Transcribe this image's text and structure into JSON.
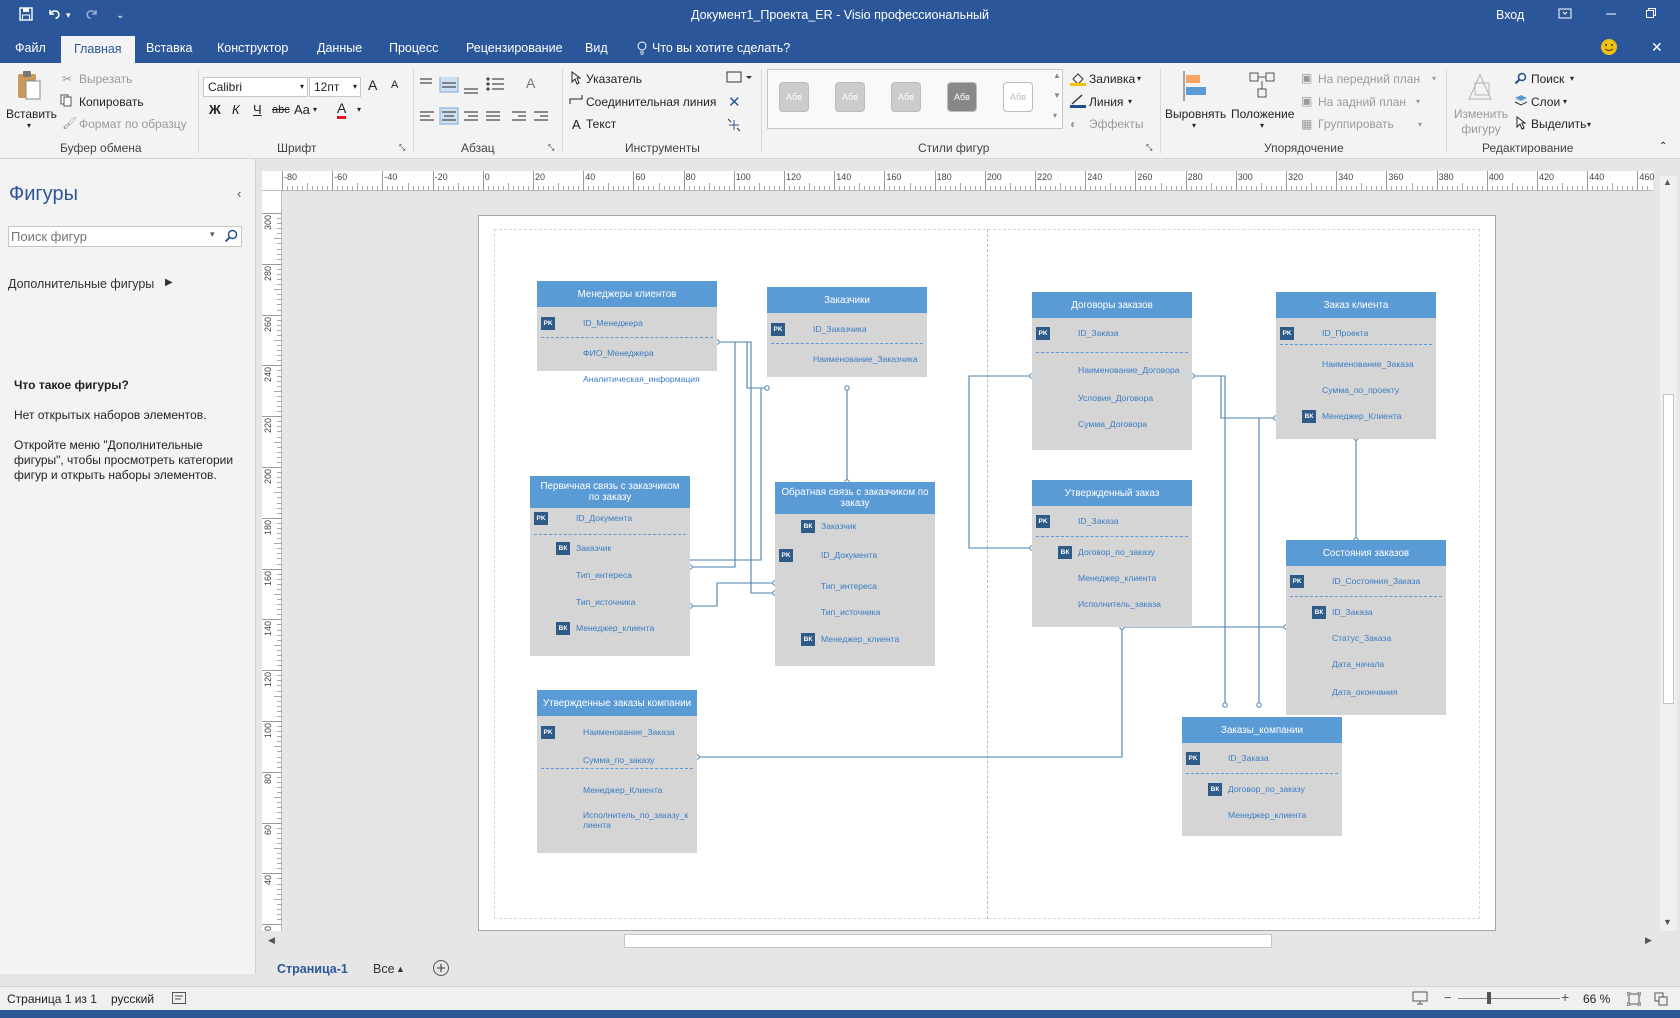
{
  "window": {
    "title": "Документ1_Проекта_ER  -  Visio профессиональный",
    "signin": "Вход"
  },
  "tabs": [
    "Файл",
    "Главная",
    "Вставка",
    "Конструктор",
    "Данные",
    "Процесс",
    "Рецензирование",
    "Вид"
  ],
  "tell_me": "Что вы хотите сделать?",
  "ribbon": {
    "clipboard": {
      "paste": "Вставить",
      "cut": "Вырезать",
      "copy": "Копировать",
      "format_painter": "Формат по образцу",
      "label": "Буфер обмена"
    },
    "font": {
      "family": "Calibri",
      "size": "12пт",
      "bold": "Ж",
      "italic": "К",
      "underline": "Ч",
      "strike": "abc",
      "case": "Aa",
      "color_letter": "A",
      "grow": "A",
      "shrink": "A",
      "label": "Шрифт"
    },
    "paragraph": {
      "label": "Абзац"
    },
    "tools": {
      "pointer": "Указатель",
      "connector": "Соединительная линия",
      "text": "Текст",
      "label": "Инструменты"
    },
    "styles": {
      "sample": "Абв",
      "label": "Стили фигур",
      "fill": "Заливка",
      "line": "Линия",
      "effects": "Эффекты"
    },
    "arrange": {
      "align": "Выровнять",
      "position": "Положение",
      "front": "На передний план",
      "back": "На задний план",
      "group": "Группировать",
      "label": "Упорядочение"
    },
    "editing": {
      "change_shape": "Изменить фигуру",
      "find": "Поиск",
      "layers": "Слои",
      "select": "Выделить",
      "label": "Редактирование"
    }
  },
  "shapes_panel": {
    "title": "Фигуры",
    "search_placeholder": "Поиск фигур",
    "more_shapes": "Дополнительные фигуры",
    "help_title": "Что такое фигуры?",
    "help_text1": "Нет открытых наборов элементов.",
    "help_text2": "Откройте меню \"Дополнительные фигуры\", чтобы просмотреть категории фигур и открыть наборы элементов."
  },
  "ruler_h": [
    "-80",
    "-60",
    "-40",
    "-20",
    "0",
    "20",
    "40",
    "60",
    "80",
    "100",
    "120",
    "140",
    "160",
    "180",
    "200",
    "220",
    "240",
    "260",
    "280",
    "300",
    "320",
    "340",
    "360",
    "380",
    "400",
    "420",
    "440",
    "460"
  ],
  "ruler_v": [
    "300",
    "280",
    "260",
    "240",
    "220",
    "200",
    "180",
    "160",
    "140",
    "120",
    "100",
    "80",
    "60",
    "40",
    "20"
  ],
  "entities": [
    {
      "title": "Менеджеры клиентов",
      "rows": [
        {
          "key": "PK",
          "name": "ID_Менеджера"
        },
        {
          "key": "",
          "name": "ФИО_Менеджера"
        },
        {
          "key": "",
          "name": "Аналитическая_информация"
        }
      ]
    },
    {
      "title": "Заказчики",
      "rows": [
        {
          "key": "PK",
          "name": "ID_Заказчика"
        },
        {
          "key": "",
          "name": "Наименование_Заказчика"
        }
      ]
    },
    {
      "title": "Первичная связь с заказчиком по заказу",
      "rows": [
        {
          "key": "PK",
          "name": "ID_Документа"
        },
        {
          "key": "ВК",
          "name": "Заказчик"
        },
        {
          "key": "",
          "name": "Тип_интереса"
        },
        {
          "key": "",
          "name": "Тип_источника"
        },
        {
          "key": "ВК",
          "name": "Менеджер_клиента"
        }
      ]
    },
    {
      "title": "Обратная связь с заказчиком по заказу",
      "rows": [
        {
          "key": "ВК",
          "name": "Заказчик"
        },
        {
          "key": "PK",
          "name": "ID_Документа"
        },
        {
          "key": "",
          "name": "Тип_интереса"
        },
        {
          "key": "",
          "name": "Тип_источника"
        },
        {
          "key": "ВК",
          "name": "Менеджер_клиента"
        }
      ]
    },
    {
      "title": "Утвержденные заказы компании",
      "rows": [
        {
          "key": "PK",
          "name": "Наименование_Заказа"
        },
        {
          "key": "",
          "name": "Сумма_по_заказу"
        },
        {
          "key": "",
          "name": "Менеджер_Клиента"
        },
        {
          "key": "",
          "name": "Исполнитель_по_заказу_к лиента"
        }
      ]
    },
    {
      "title": "Договоры заказов",
      "rows": [
        {
          "key": "PK",
          "name": "ID_Заказа"
        },
        {
          "key": "",
          "name": "Наименование_Договора"
        },
        {
          "key": "",
          "name": "Условия_Договора"
        },
        {
          "key": "",
          "name": "Сумма_Договора"
        }
      ]
    },
    {
      "title": "Заказ клиента",
      "rows": [
        {
          "key": "PK",
          "name": "ID_Проекта"
        },
        {
          "key": "",
          "name": "Наименование_Заказа"
        },
        {
          "key": "",
          "name": "Сумма_по_проекту"
        },
        {
          "key": "ВК",
          "name": "Менеджер_Клиента"
        }
      ]
    },
    {
      "title": "Утвержденный заказ",
      "rows": [
        {
          "key": "PK",
          "name": "ID_Заказа"
        },
        {
          "key": "ВК",
          "name": "Договор_по_заказу"
        },
        {
          "key": "",
          "name": "Менеджер_клиента"
        },
        {
          "key": "",
          "name": "Исполнитель_заказа"
        }
      ]
    },
    {
      "title": "Состояния заказов",
      "rows": [
        {
          "key": "PK",
          "name": "ID_Состояния_Заказа"
        },
        {
          "key": "ВК",
          "name": "ID_Заказа"
        },
        {
          "key": "",
          "name": "Статус_Заказа"
        },
        {
          "key": "",
          "name": "Дата_начала"
        },
        {
          "key": "",
          "name": "Дата_окончания"
        }
      ]
    },
    {
      "title": "Заказы_компании",
      "rows": [
        {
          "key": "PK",
          "name": "ID_Заказа"
        },
        {
          "key": "ВК",
          "name": "Договор_по_заказу"
        },
        {
          "key": "",
          "name": "Менеджер_клиента"
        }
      ]
    }
  ],
  "pages": {
    "current": "Страница-1",
    "all": "Все"
  },
  "status": {
    "page": "Страница 1 из 1",
    "lang": "русский",
    "zoom": "66 %"
  },
  "colors": {
    "accent": "#2b579a",
    "entity_header": "#5b9bd5",
    "entity_body": "#d5d5d5",
    "key_badge": "#2e5b88",
    "field_text": "#3a7cc3",
    "connector": "#4a7fb0"
  }
}
